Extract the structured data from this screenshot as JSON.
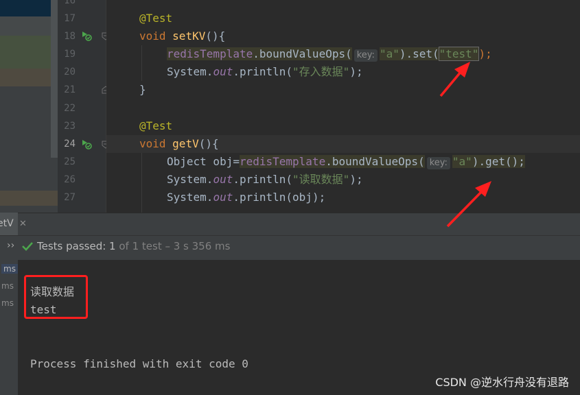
{
  "editor": {
    "line_numbers": [
      "16",
      "17",
      "18",
      "19",
      "20",
      "21",
      "22",
      "23",
      "24",
      "25",
      "26",
      "27"
    ],
    "current_line": "24",
    "lines": {
      "l17_ann": "@Test",
      "l18_kw": "void",
      "l18_fn": "setKV",
      "l18_rest": "(){",
      "l19_obj": "redisTemplate",
      "l19_call": ".boundValueOps(",
      "l19_hint": "key:",
      "l19_arg": "\"a\"",
      "l19_tail1": ").set(",
      "l19_val": "\"test\"",
      "l19_tail2": ");",
      "l20_a": "System.",
      "l20_out": "out",
      "l20_b": ".println(",
      "l20_str": "\"存入数据\"",
      "l20_c": ");",
      "l21": "}",
      "l23_ann": "@Test",
      "l24_kw": "void",
      "l24_fn": "getV",
      "l24_rest": "(){",
      "l25_a": "Object obj=",
      "l25_obj": "redisTemplate",
      "l25_call": ".boundValueOps(",
      "l25_hint": "key:",
      "l25_arg": "\"a\"",
      "l25_tail": ").get();",
      "l26_a": "System.",
      "l26_out": "out",
      "l26_b": ".println(",
      "l26_str": "\"读取数据\"",
      "l26_c": ");",
      "l27_a": "System.",
      "l27_out": "out",
      "l27_b": ".println(obj);"
    }
  },
  "run_window": {
    "tab_label": "etV",
    "tab_close": "✕",
    "chevrons": "››",
    "status_prefix": "Tests passed: ",
    "status_count": "1",
    "status_rest": " of 1 test – 3 s 356 ms",
    "tree_items": [
      "ms",
      "ms",
      "ms"
    ],
    "console_lines": [
      "读取数据",
      "test",
      "Process finished with exit code 0"
    ]
  },
  "watermark": "CSDN @逆水行舟没有退路",
  "colors": {
    "annotation_red": "#ff1f1f",
    "pass_green": "#4ca64c",
    "editor_bg": "#2b2b2b"
  },
  "icons": [
    "run-test-icon",
    "fold-icon",
    "lightbulb-icon",
    "check-icon",
    "close-icon"
  ]
}
